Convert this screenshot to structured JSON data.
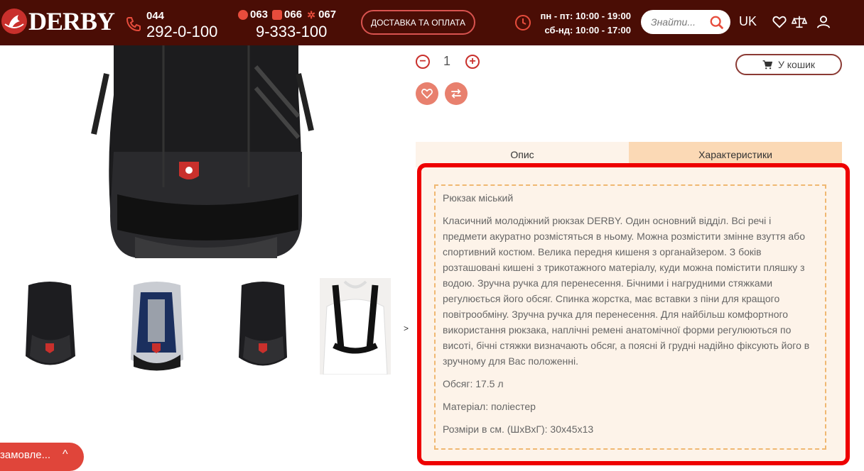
{
  "header": {
    "logo_text": "DERBY",
    "phone_code": "044",
    "phone_number": "292-0-100",
    "mobile_codes": [
      "063",
      "066",
      "067"
    ],
    "mobile_number": "9-333-100",
    "delivery_label": "ДОСТАВКА ТА ОПЛАТА",
    "hours_weekdays": "пн - пт: 10:00 - 19:00",
    "hours_weekend": "сб-нд: 10:00 - 17:00",
    "search_placeholder": "Знайти...",
    "language": "UK",
    "colors": {
      "bar": "#4a0d05",
      "accent": "#c9302c"
    }
  },
  "product": {
    "quantity": "1",
    "qty_minus": "−",
    "qty_plus": "+",
    "cart_label": "У кошик",
    "thumbs_next": ">"
  },
  "tabs": [
    {
      "label": "Опис",
      "active": false
    },
    {
      "label": "Характеристики",
      "active": true
    }
  ],
  "description": {
    "title": "Рюкзак міський",
    "body": "Класичний молодіжний рюкзак DERBY. Один основний відділ. Всі речі і предмети акуратно розмістяться в ньому. Можна розмістити змінне взуття або спортивний костюм. Велика передня кишеня з органайзером. З боків розташовані кишені з трикотажного матеріалу, куди можна помістити пляшку з водою. Зручна ручка для перенесення. Бічними і нагрудними стяжками регулюється його обсяг. Спинка жорстка, має вставки з піни для кращого повітрообміну. Зручна ручка для перенесення. Для найбільш комфортного використання рюкзака, наплічні ремені анатомічної форми регулюються по висоті, бічні стяжки визначають обсяг, а поясні й грудні надійно фіксують його в зручному для Вас положенні.",
    "volume": "Обсяг: 17.5 л",
    "material": "Матеріал: поліестер",
    "dimensions": "Розміри в см. (ШхВхГ): 30х45х13"
  },
  "order_tab": {
    "label": "замовле...",
    "chevron": "^"
  }
}
